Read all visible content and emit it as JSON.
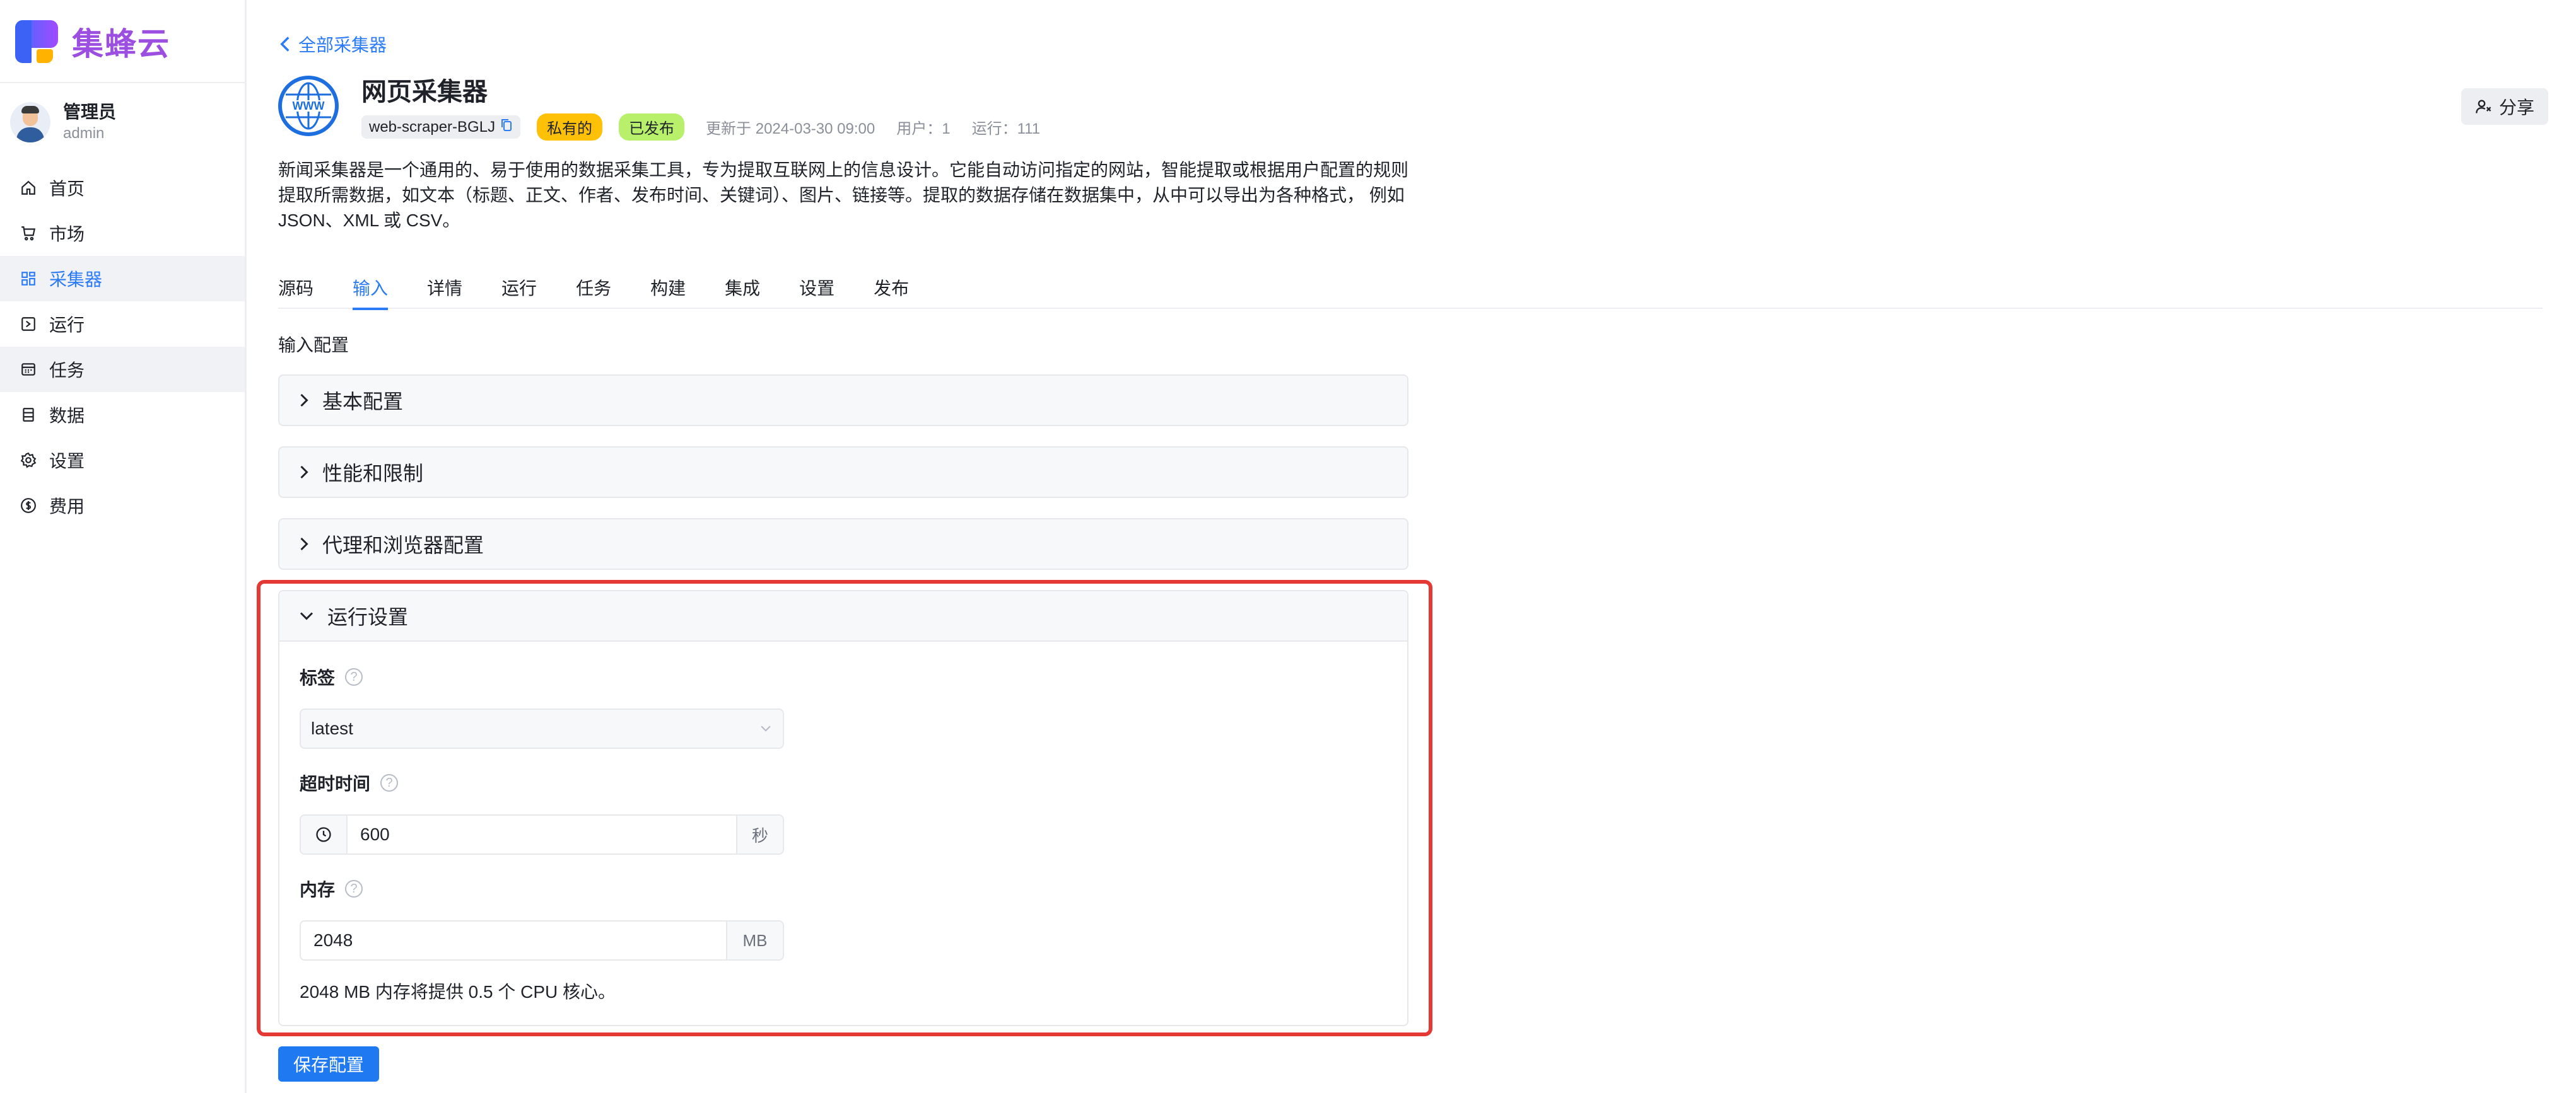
{
  "brand": {
    "name": "集蜂云"
  },
  "user": {
    "name": "管理员",
    "id": "admin"
  },
  "nav": [
    {
      "label": "首页",
      "icon": "home-icon"
    },
    {
      "label": "市场",
      "icon": "cart-icon"
    },
    {
      "label": "采集器",
      "icon": "grid-icon",
      "active": true
    },
    {
      "label": "运行",
      "icon": "run-icon"
    },
    {
      "label": "任务",
      "icon": "calendar-icon"
    },
    {
      "label": "数据",
      "icon": "database-icon"
    },
    {
      "label": "设置",
      "icon": "gear-icon"
    },
    {
      "label": "费用",
      "icon": "dollar-icon"
    }
  ],
  "back_link": "全部采集器",
  "scraper": {
    "title": "网页采集器",
    "slug": "web-scraper-BGLJ",
    "badge_private": "私有的",
    "badge_published": "已发布",
    "updated": "更新于 2024-03-30 09:00",
    "users": "用户：1",
    "runs": "运行：111",
    "description": "新闻采集器是一个通用的、易于使用的数据采集工具，专为提取互联网上的信息设计。它能自动访问指定的网站，智能提取或根据用户配置的规则提取所需数据，如文本（标题、正文、作者、发布时间、关键词）、图片、链接等。提取的数据存储在数据集中，从中可以导出为各种格式， 例如JSON、XML 或 CSV。"
  },
  "share_label": "分享",
  "tabs": [
    "源码",
    "输入",
    "详情",
    "运行",
    "任务",
    "构建",
    "集成",
    "设置",
    "发布"
  ],
  "active_tab": "输入",
  "section_label": "输入配置",
  "panels": [
    "基本配置",
    "性能和限制",
    "代理和浏览器配置"
  ],
  "run_settings": {
    "title": "运行设置",
    "tag_label": "标签",
    "tag_value": "latest",
    "timeout_label": "超时时间",
    "timeout_value": "600",
    "timeout_unit": "秒",
    "memory_label": "内存",
    "memory_value": "2048",
    "memory_unit": "MB",
    "memory_hint": "2048 MB 内存将提供 0.5 个 CPU 核心。"
  },
  "save_label": "保存配置",
  "colors": {
    "accent": "#2b7bf6",
    "highlight": "#e53935",
    "private": "#ffc107",
    "published": "#b8f06b"
  }
}
